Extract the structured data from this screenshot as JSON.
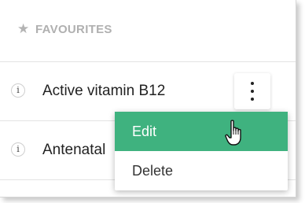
{
  "favourites": {
    "title": "FAVOURITES",
    "star_icon": "star-icon"
  },
  "items": [
    {
      "label": "Active vitamin B12",
      "info_icon": "i"
    },
    {
      "label": "Antenatal",
      "info_icon": "i"
    }
  ],
  "context_menu": {
    "items": [
      {
        "label": "Edit",
        "state": "hovered"
      },
      {
        "label": "Delete",
        "state": "normal"
      }
    ]
  },
  "colors": {
    "accent": "#3fb27f",
    "header_text": "#b0b0b0",
    "row_text": "#222222"
  },
  "icons": {
    "more": "vertical-dots-icon",
    "cursor": "hand-pointer-icon"
  }
}
